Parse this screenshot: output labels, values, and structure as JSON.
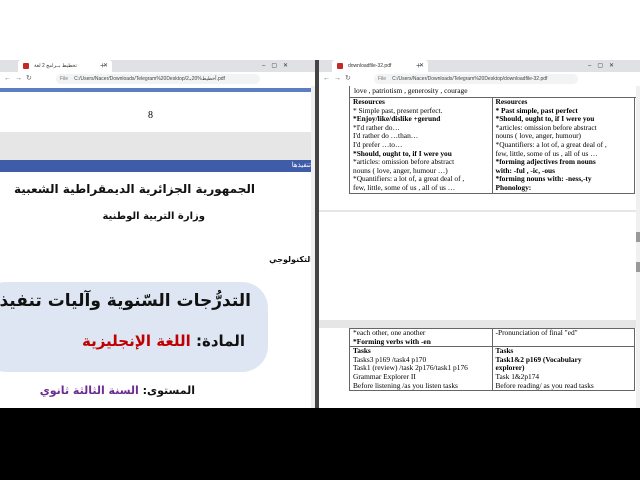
{
  "left_window": {
    "tab_title": "تخطيط بـ‌ـرامج 2 لغة",
    "url": "C:/Users/Nacer/Downloads/Telegram%20Desktop/2أخطيط%20بـ.pdf",
    "file_label": "File"
  },
  "right_window": {
    "tab_title": "downloadfile-32.pdf",
    "url": "C:/Users/Nacer/Downloads/Telegram%20Desktop/downloadfile-32.pdf",
    "file_label": "File"
  },
  "left_doc": {
    "page_number": "8",
    "bar_text": "تنفيذها",
    "republic": "الجمهورية الجزائرية الديمقراطية الشعبية",
    "ministry": "وزارة التربية الوطنية",
    "techno": "التكنولوجي",
    "title": "التدرُّجات السّنوية وآليات تنفيذ",
    "subject_label": "المادة:",
    "subject_value": "اللغة الإنجليزية",
    "level_label": "المستوى:",
    "level_value": "السنة الثالثة ثانوي"
  },
  "right_doc": {
    "top_line": "love , patriotism , generosity , courage",
    "col1": {
      "heading": "Resources",
      "lines": [
        "* Simple past, present perfect.",
        "*Enjoy/like/dislike +gerund",
        "*I'd rather do…",
        "I'd rather do …than…",
        "I'd prefer …to…",
        "*Should, ought to, if I were you",
        "*articles: omission before abstract",
        "nouns ( love, anger, humour …)",
        "*Quantifiers: a lot of, a great deal of ,",
        "few, little, some of us , all of us …"
      ]
    },
    "col2": {
      "heading": "Resources",
      "lines": [
        "* Past simple, past perfect",
        "*Should, ought to, if I were you",
        "*articles: omission before abstract",
        "nouns ( love, anger, humour)",
        "*Quantifiers: a lot of, a great deal of ,",
        "few, little, some of us , all of us …",
        "*forming adjectives from nouns",
        "with: -ful , -ic, -ous",
        "*forming nouns with: -ness,-ty",
        "Phonology:"
      ]
    },
    "lower_left": [
      "*each other, one another",
      "*Forming verbs with -en"
    ],
    "lower_right": [
      "-Pronunciation of final \"ed\""
    ],
    "tasks_left": {
      "heading": "Tasks",
      "lines": [
        "Tasks3 p169 /task4 p170",
        "Task1 (review) /task 2p176/task1 p176",
        "Grammar Explorer II",
        "Before listening /as you listen tasks"
      ]
    },
    "tasks_right": {
      "heading": "Tasks",
      "lines": [
        "Task1&2 p169 (Vocabulary",
        "explorer)",
        "Task 1&2p174",
        "Before reading/ as you read tasks"
      ]
    }
  }
}
